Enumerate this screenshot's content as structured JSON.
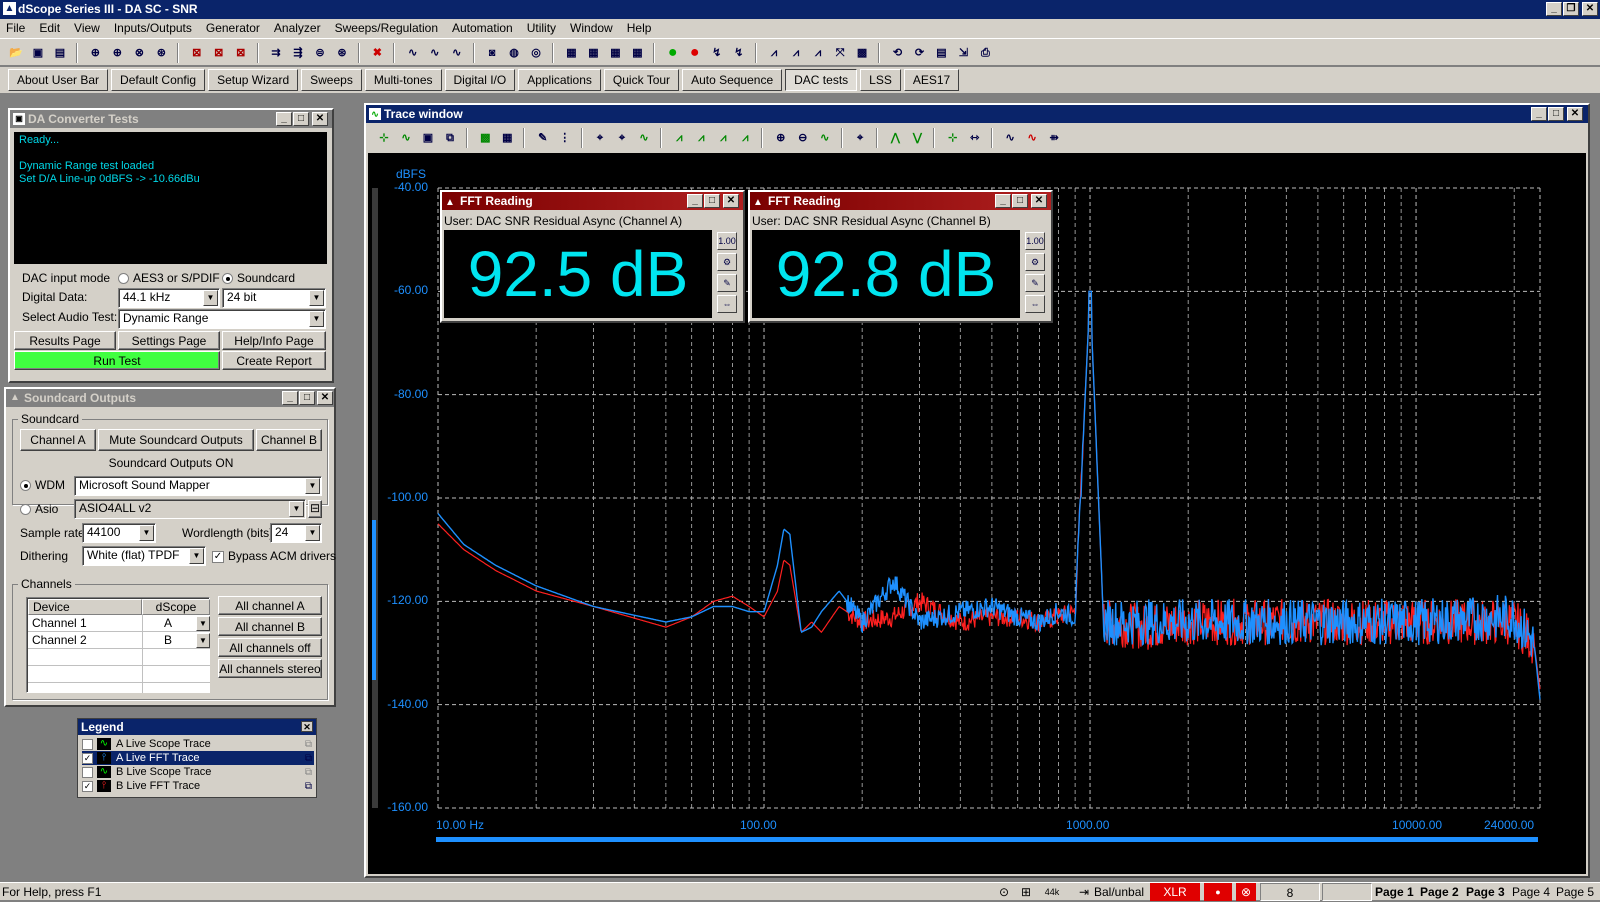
{
  "app": {
    "title": "dScope Series III - DA SC - SNR"
  },
  "menu": [
    "File",
    "Edit",
    "View",
    "Inputs/Outputs",
    "Generator",
    "Analyzer",
    "Sweeps/Regulation",
    "Automation",
    "Utility",
    "Window",
    "Help"
  ],
  "user_bar": [
    "About User Bar",
    "Default Config",
    "Setup Wizard",
    "Sweeps",
    "Multi-tones",
    "Digital I/O",
    "Applications",
    "Quick Tour",
    "Auto Sequence",
    "DAC tests",
    "LSS",
    "AES17"
  ],
  "user_bar_active": "DAC tests",
  "da_tests": {
    "title": "DA Converter Tests",
    "log": [
      "Ready...",
      "",
      "Dynamic Range test loaded",
      "Set D/A Line-up 0dBFS -> -10.66dBu"
    ],
    "dac_input_mode_label": "DAC input mode",
    "opt_aes": "AES3 or S/PDIF",
    "opt_soundcard": "Soundcard",
    "digital_data_label": "Digital Data:",
    "sample_rate": "44.1 kHz",
    "bit_depth": "24 bit",
    "select_test_label": "Select Audio Test:",
    "selected_test": "Dynamic Range",
    "results_page": "Results Page",
    "settings_page": "Settings Page",
    "help_page": "Help/Info Page",
    "run_test": "Run Test",
    "create_report": "Create Report"
  },
  "soundcard": {
    "title": "Soundcard Outputs",
    "group": "Soundcard",
    "channel_a": "Channel A",
    "mute": "Mute Soundcard Outputs",
    "channel_b": "Channel B",
    "status": "Soundcard Outputs ON",
    "wdm_label": "WDM",
    "wdm_value": "Microsoft Sound Mapper",
    "asio_label": "Asio",
    "asio_value": "ASIO4ALL v2",
    "sample_rate_label": "Sample rate",
    "sample_rate": "44100",
    "wordlength_label": "Wordlength (bits)",
    "wordlength": "24",
    "dithering_label": "Dithering",
    "dithering": "White (flat) TPDF",
    "bypass": "Bypass ACM drivers",
    "channels_group": "Channels",
    "col_device": "Device",
    "col_dscope": "dScope",
    "rows": [
      {
        "device": "Channel 1",
        "dscope": "A"
      },
      {
        "device": "Channel 2",
        "dscope": "B"
      }
    ],
    "all_a": "All channel A",
    "all_b": "All channel B",
    "all_off": "All channels off",
    "all_stereo": "All channels stereo"
  },
  "legend": {
    "title": "Legend",
    "items": [
      {
        "label": "A  Live Scope Trace",
        "checked": false
      },
      {
        "label": "A  Live FFT Trace",
        "checked": true
      },
      {
        "label": "B  Live Scope Trace",
        "checked": false
      },
      {
        "label": "B  Live FFT Trace",
        "checked": true
      }
    ]
  },
  "trace": {
    "title": "Trace window",
    "y_unit": "dBFS"
  },
  "fft_a": {
    "title": "FFT Reading",
    "subtitle": "User: DAC SNR Residual Async (Channel A)",
    "value": "92.5 dB"
  },
  "fft_b": {
    "title": "FFT Reading",
    "subtitle": "User: DAC SNR Residual Async (Channel B)",
    "value": "92.8 dB"
  },
  "chart_data": {
    "type": "line",
    "title": "",
    "ylabel": "dBFS",
    "xlabel": "",
    "x_scale": "log",
    "xlim": [
      10,
      24000
    ],
    "ylim": [
      -160,
      -40
    ],
    "x_ticks": [
      "10.00 Hz",
      "100.00",
      "1000.00",
      "10000.00",
      "24000.00"
    ],
    "y_ticks": [
      "-40.00",
      "-60.00",
      "-80.00",
      "-100.00",
      "-120.00",
      "-140.00",
      "-160.00"
    ],
    "grid": true,
    "series": [
      {
        "color": "#ff2020",
        "x": [
          10,
          12,
          15,
          20,
          30,
          50,
          60,
          70,
          80,
          90,
          100,
          110,
          115,
          120,
          130,
          140,
          150,
          170,
          200,
          250,
          300,
          400,
          500,
          600,
          700,
          800,
          900,
          1000,
          1100,
          1500,
          2000,
          5000,
          10000,
          20000,
          23000,
          24000
        ],
        "y": [
          -105,
          -110,
          -114,
          -118,
          -121,
          -125,
          -123,
          -120,
          -119,
          -121,
          -123,
          -118,
          -112,
          -113,
          -126,
          -124,
          -126,
          -121,
          -124,
          -123,
          -120,
          -124,
          -123,
          -123,
          -124,
          -123,
          -122,
          -60,
          -124,
          -125,
          -124,
          -124,
          -124,
          -124,
          -128,
          -137
        ]
      },
      {
        "color": "#1e90ff",
        "x": [
          10,
          12,
          15,
          20,
          30,
          50,
          60,
          70,
          80,
          90,
          100,
          110,
          115,
          120,
          130,
          140,
          150,
          170,
          200,
          250,
          300,
          400,
          500,
          600,
          700,
          800,
          900,
          1000,
          1100,
          1500,
          2000,
          5000,
          10000,
          20000,
          23000,
          24000
        ],
        "y": [
          -103,
          -109,
          -113,
          -117,
          -121,
          -124,
          -123,
          -121,
          -121,
          -122,
          -122,
          -113,
          -106,
          -107,
          -126,
          -125,
          -122,
          -118,
          -124,
          -116,
          -124,
          -122,
          -121,
          -123,
          -124,
          -122,
          -123,
          -60,
          -124,
          -124,
          -124,
          -124,
          -124,
          -123,
          -128,
          -139
        ]
      }
    ]
  },
  "status": {
    "help": "For Help, press F1",
    "balunbal": "Bal/unbal",
    "xlr": "XLR",
    "num": "8",
    "pages": [
      "Page 1",
      "Page 2",
      "Page 3",
      "Page 4",
      "Page 5"
    ]
  }
}
